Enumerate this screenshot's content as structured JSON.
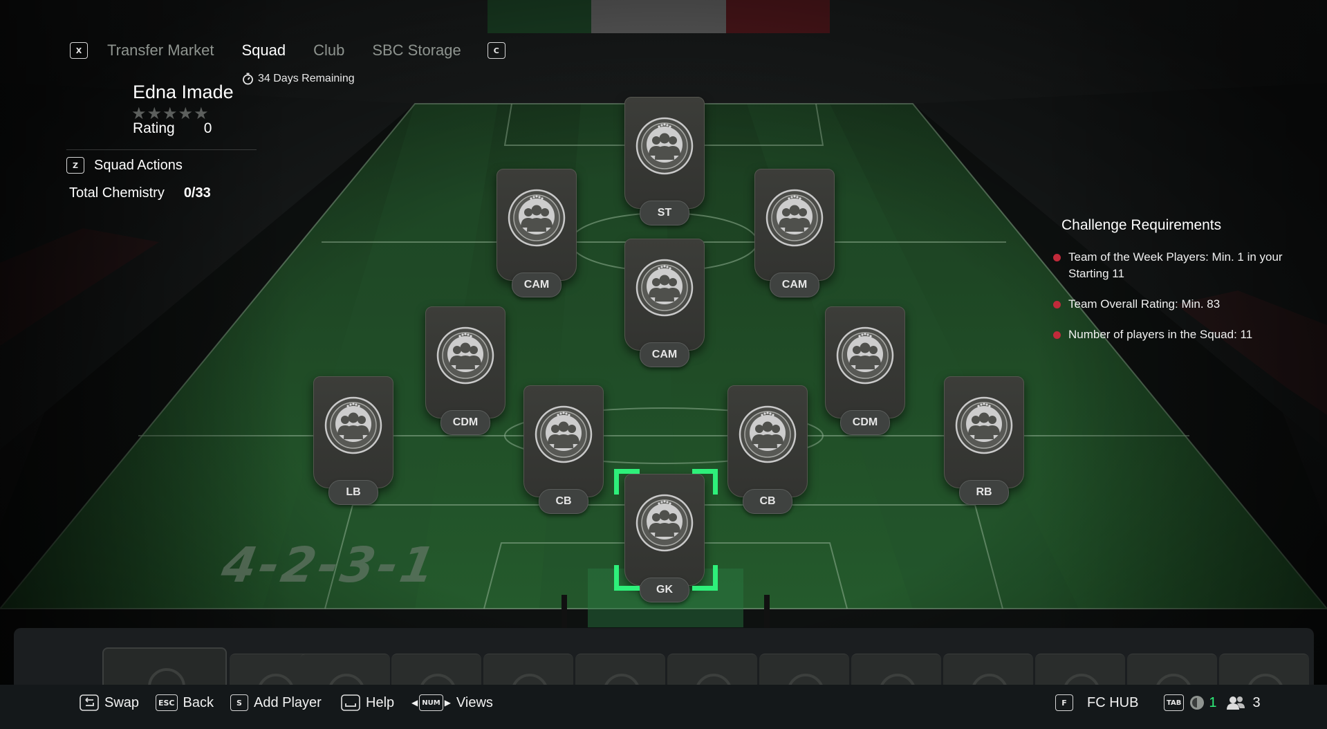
{
  "nav": {
    "left_key": "X",
    "right_key": "C",
    "tabs": [
      {
        "label": "Transfer Market",
        "active": false
      },
      {
        "label": "Squad",
        "active": true
      },
      {
        "label": "Club",
        "active": false
      },
      {
        "label": "SBC Storage",
        "active": false
      }
    ]
  },
  "squad": {
    "timer": "34 Days Remaining",
    "name": "Edna Imade",
    "stars": "★★★★★",
    "rating_label": "Rating",
    "rating_value": "0",
    "actions_key": "Z",
    "actions_label": "Squad Actions",
    "chemistry_label": "Total Chemistry",
    "chemistry_value": "0/33",
    "formation": "4-2-3-1"
  },
  "positions": {
    "st": "ST",
    "cam_left": "CAM",
    "cam_center": "CAM",
    "cam_right": "CAM",
    "cdm_left": "CDM",
    "cdm_right": "CDM",
    "lb": "LB",
    "cb_left": "CB",
    "cb_right": "CB",
    "rb": "RB",
    "gk": "GK",
    "selected": "GK"
  },
  "requirements": {
    "title": "Challenge Requirements",
    "items": [
      "Team of the Week Players: Min. 1 in your Starting 11",
      "Team Overall Rating: Min. 83",
      "Number of players in the Squad: 11"
    ],
    "status_color": "#c12a3a"
  },
  "controls": {
    "swap_label": "Swap",
    "back_key": "ESC",
    "back_label": "Back",
    "add_key": "S",
    "add_label": "Add Player",
    "help_label": "Help",
    "views_key": "NUM",
    "views_label": "Views",
    "hub_key": "F",
    "hub_label": "FC HUB",
    "tab_key": "TAB",
    "notifications_count": "1",
    "friends_count": "3"
  },
  "colors": {
    "accent": "#2ef07a",
    "pitch": "#1f4d26",
    "requirement_dot": "#c12a3a"
  },
  "icons": [
    "stopwatch-icon",
    "player-silhouette-icon",
    "swap-icon",
    "help-key-icon",
    "notification-icon",
    "friends-icon"
  ]
}
